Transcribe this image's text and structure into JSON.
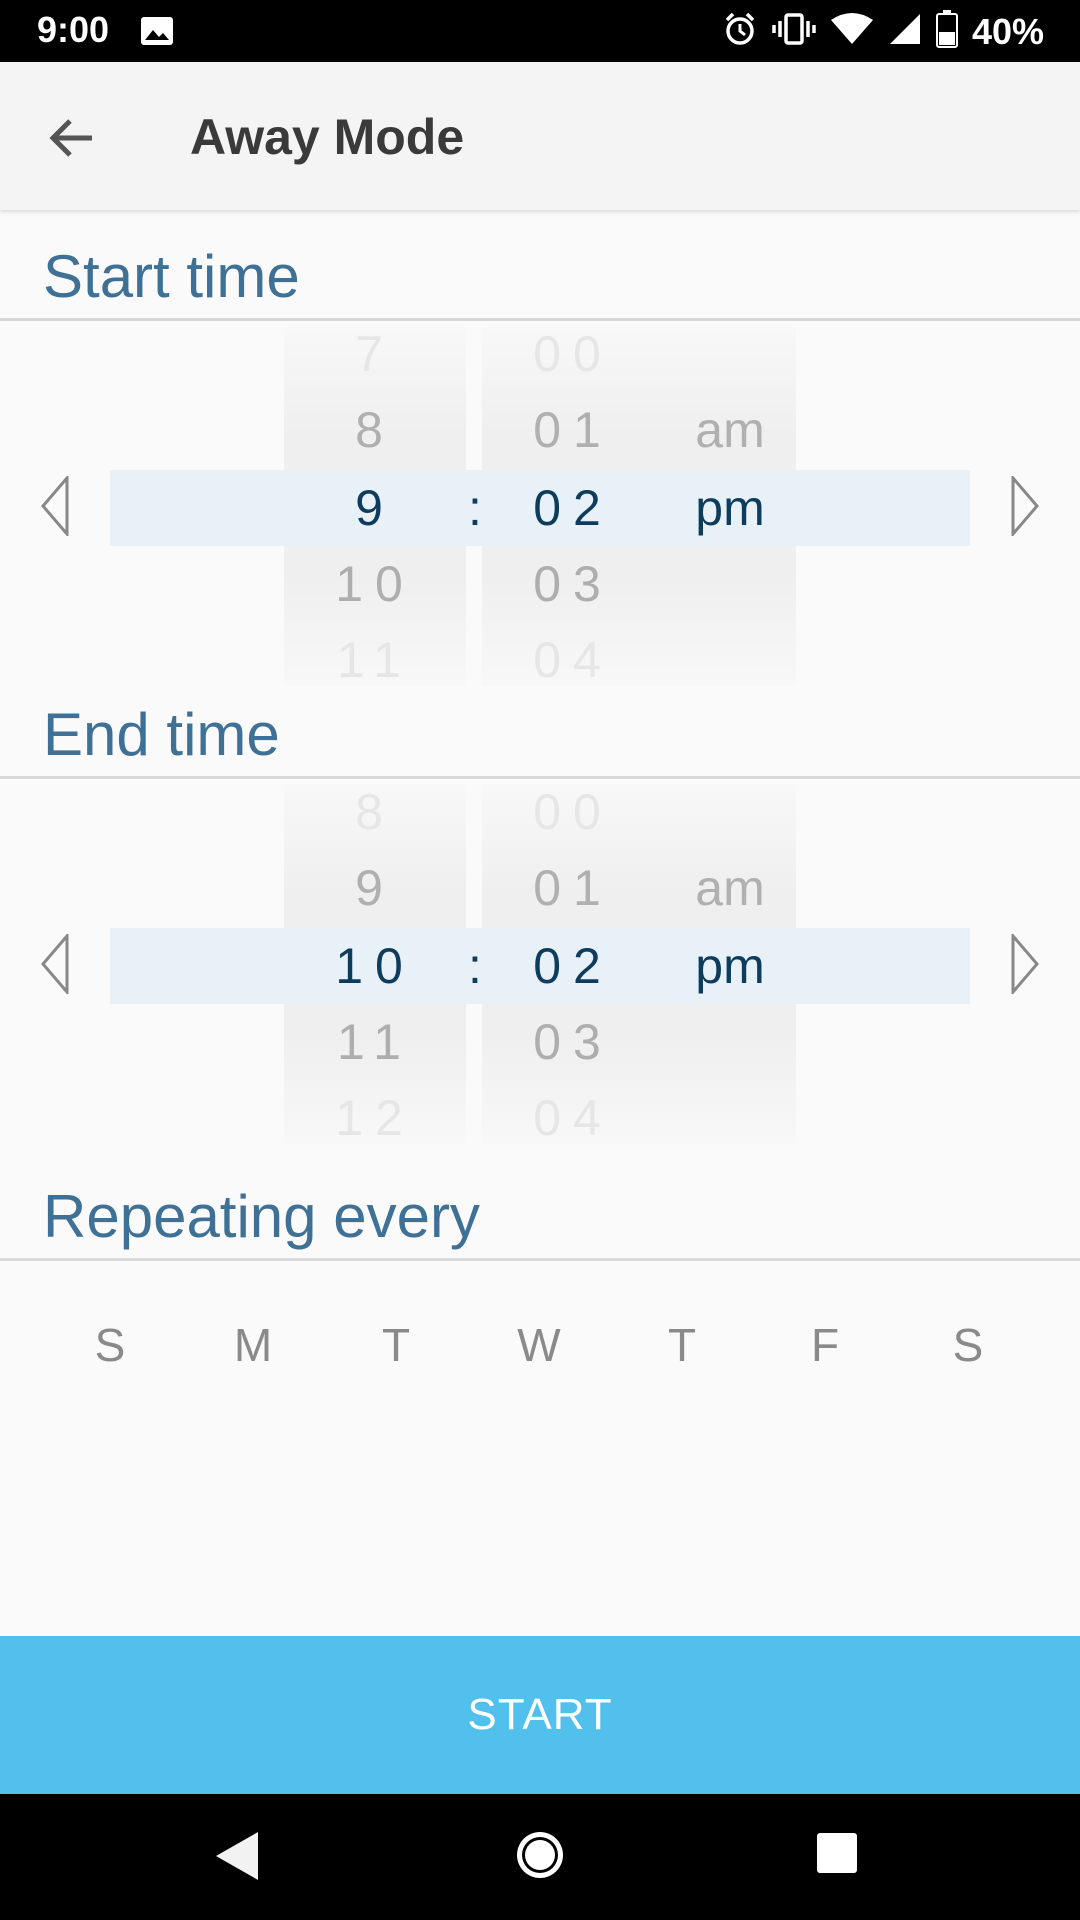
{
  "status_bar": {
    "time": "9:00",
    "battery": "40%"
  },
  "app_bar": {
    "title": "Away Mode"
  },
  "start_time": {
    "title": "Start time",
    "hours": [
      "7",
      "8",
      "9",
      "10",
      "11"
    ],
    "minutes": [
      "00",
      "01",
      "02",
      "03",
      "04"
    ],
    "periods": [
      "",
      "am",
      "pm",
      "",
      ""
    ],
    "separator": ":"
  },
  "end_time": {
    "title": "End time",
    "hours": [
      "8",
      "9",
      "10",
      "11",
      "12"
    ],
    "minutes": [
      "00",
      "01",
      "02",
      "03",
      "04"
    ],
    "periods": [
      "",
      "am",
      "pm",
      "",
      ""
    ],
    "separator": ":"
  },
  "repeat": {
    "title": "Repeating every",
    "days": [
      "S",
      "M",
      "T",
      "W",
      "T",
      "F",
      "S"
    ]
  },
  "start_button": {
    "label": "START"
  }
}
